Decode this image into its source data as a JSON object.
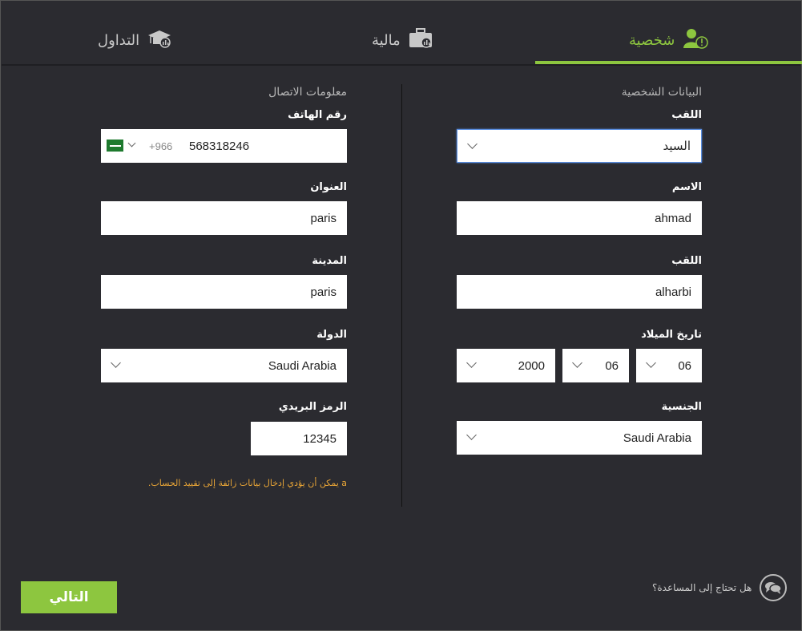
{
  "tabs": {
    "personal": "شخصية",
    "financial": "مالية",
    "trading": "التداول"
  },
  "personal_section": {
    "title": "البيانات الشخصية",
    "title_label": "اللقب",
    "title_value": "السيد",
    "first_name_label": "الاسم",
    "first_name_value": "ahmad",
    "last_name_label": "اللقب",
    "last_name_value": "alharbi",
    "dob_label": "تاريخ الميلاد",
    "dob_year": "2000",
    "dob_month": "06",
    "dob_day": "06",
    "nationality_label": "الجنسية",
    "nationality_value": "Saudi Arabia"
  },
  "contact_section": {
    "title": "معلومات الاتصال",
    "phone_label": "رقم الهاتف",
    "phone_code": "+966",
    "phone_value": "568318246",
    "address_label": "العنوان",
    "address_value": "paris",
    "city_label": "المدينة",
    "city_value": "paris",
    "country_label": "الدولة",
    "country_value": "Saudi Arabia",
    "zip_label": "الرمز البريدي",
    "zip_value": "12345",
    "warning": "a يمكن أن يؤدي إدخال بيانات زائفة إلى تقييد الحساب."
  },
  "footer": {
    "next_label": "التالي",
    "help_label": "هل تحتاج إلى المساعدة؟"
  },
  "colors": {
    "accent": "#8dc63f",
    "background": "#2b2b30",
    "warning": "#e7a436"
  },
  "icons": {
    "personal": "user-alert-icon",
    "financial": "briefcase-chart-icon",
    "trading": "graduation-chart-icon",
    "help": "chat-bubbles-icon"
  }
}
